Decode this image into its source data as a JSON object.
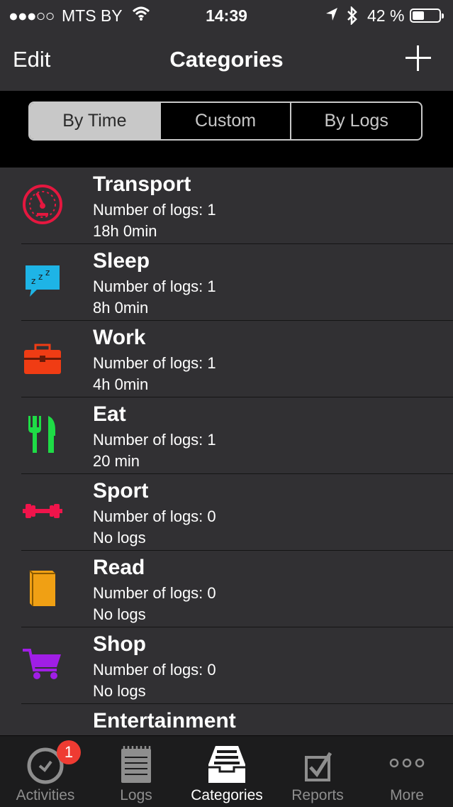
{
  "status_bar": {
    "signal": "●●●○○",
    "carrier": "MTS BY",
    "time": "14:39",
    "battery_percent": "42 %",
    "battery_level": 0.42
  },
  "nav": {
    "edit_label": "Edit",
    "title": "Categories",
    "add_icon": "plus-icon"
  },
  "segments": {
    "options": [
      "By Time",
      "Custom",
      "By Logs"
    ],
    "selected": "By Time"
  },
  "categories": [
    {
      "name": "Transport",
      "count": "Number of logs: 1",
      "duration": "18h 0min",
      "icon": "speedometer-icon",
      "color": "#e5173f"
    },
    {
      "name": "Sleep",
      "count": "Number of logs: 1",
      "duration": "8h 0min",
      "icon": "sleep-bubble-icon",
      "color": "#1eb4e6"
    },
    {
      "name": "Work",
      "count": "Number of logs: 1",
      "duration": "4h 0min",
      "icon": "toolbox-icon",
      "color": "#f03c14"
    },
    {
      "name": "Eat",
      "count": "Number of logs: 1",
      "duration": "20 min",
      "icon": "fork-knife-icon",
      "color": "#1edc46"
    },
    {
      "name": "Sport",
      "count": "Number of logs: 0",
      "duration": "No logs",
      "icon": "dumbbell-icon",
      "color": "#f0144b"
    },
    {
      "name": "Read",
      "count": "Number of logs: 0",
      "duration": "No logs",
      "icon": "book-icon",
      "color": "#f0a014"
    },
    {
      "name": "Shop",
      "count": "Number of logs: 0",
      "duration": "No logs",
      "icon": "cart-icon",
      "color": "#a01ee6"
    },
    {
      "name": "Entertainment",
      "count": "",
      "duration": "",
      "icon": "entertainment-icon",
      "color": "#e61e8c"
    }
  ],
  "tabs": [
    {
      "label": "Activities",
      "icon": "clock-icon",
      "badge": "1"
    },
    {
      "label": "Logs",
      "icon": "notepad-icon"
    },
    {
      "label": "Categories",
      "icon": "inbox-tray-icon",
      "active": true
    },
    {
      "label": "Reports",
      "icon": "checkbox-icon"
    },
    {
      "label": "More",
      "icon": "more-dots-icon"
    }
  ]
}
